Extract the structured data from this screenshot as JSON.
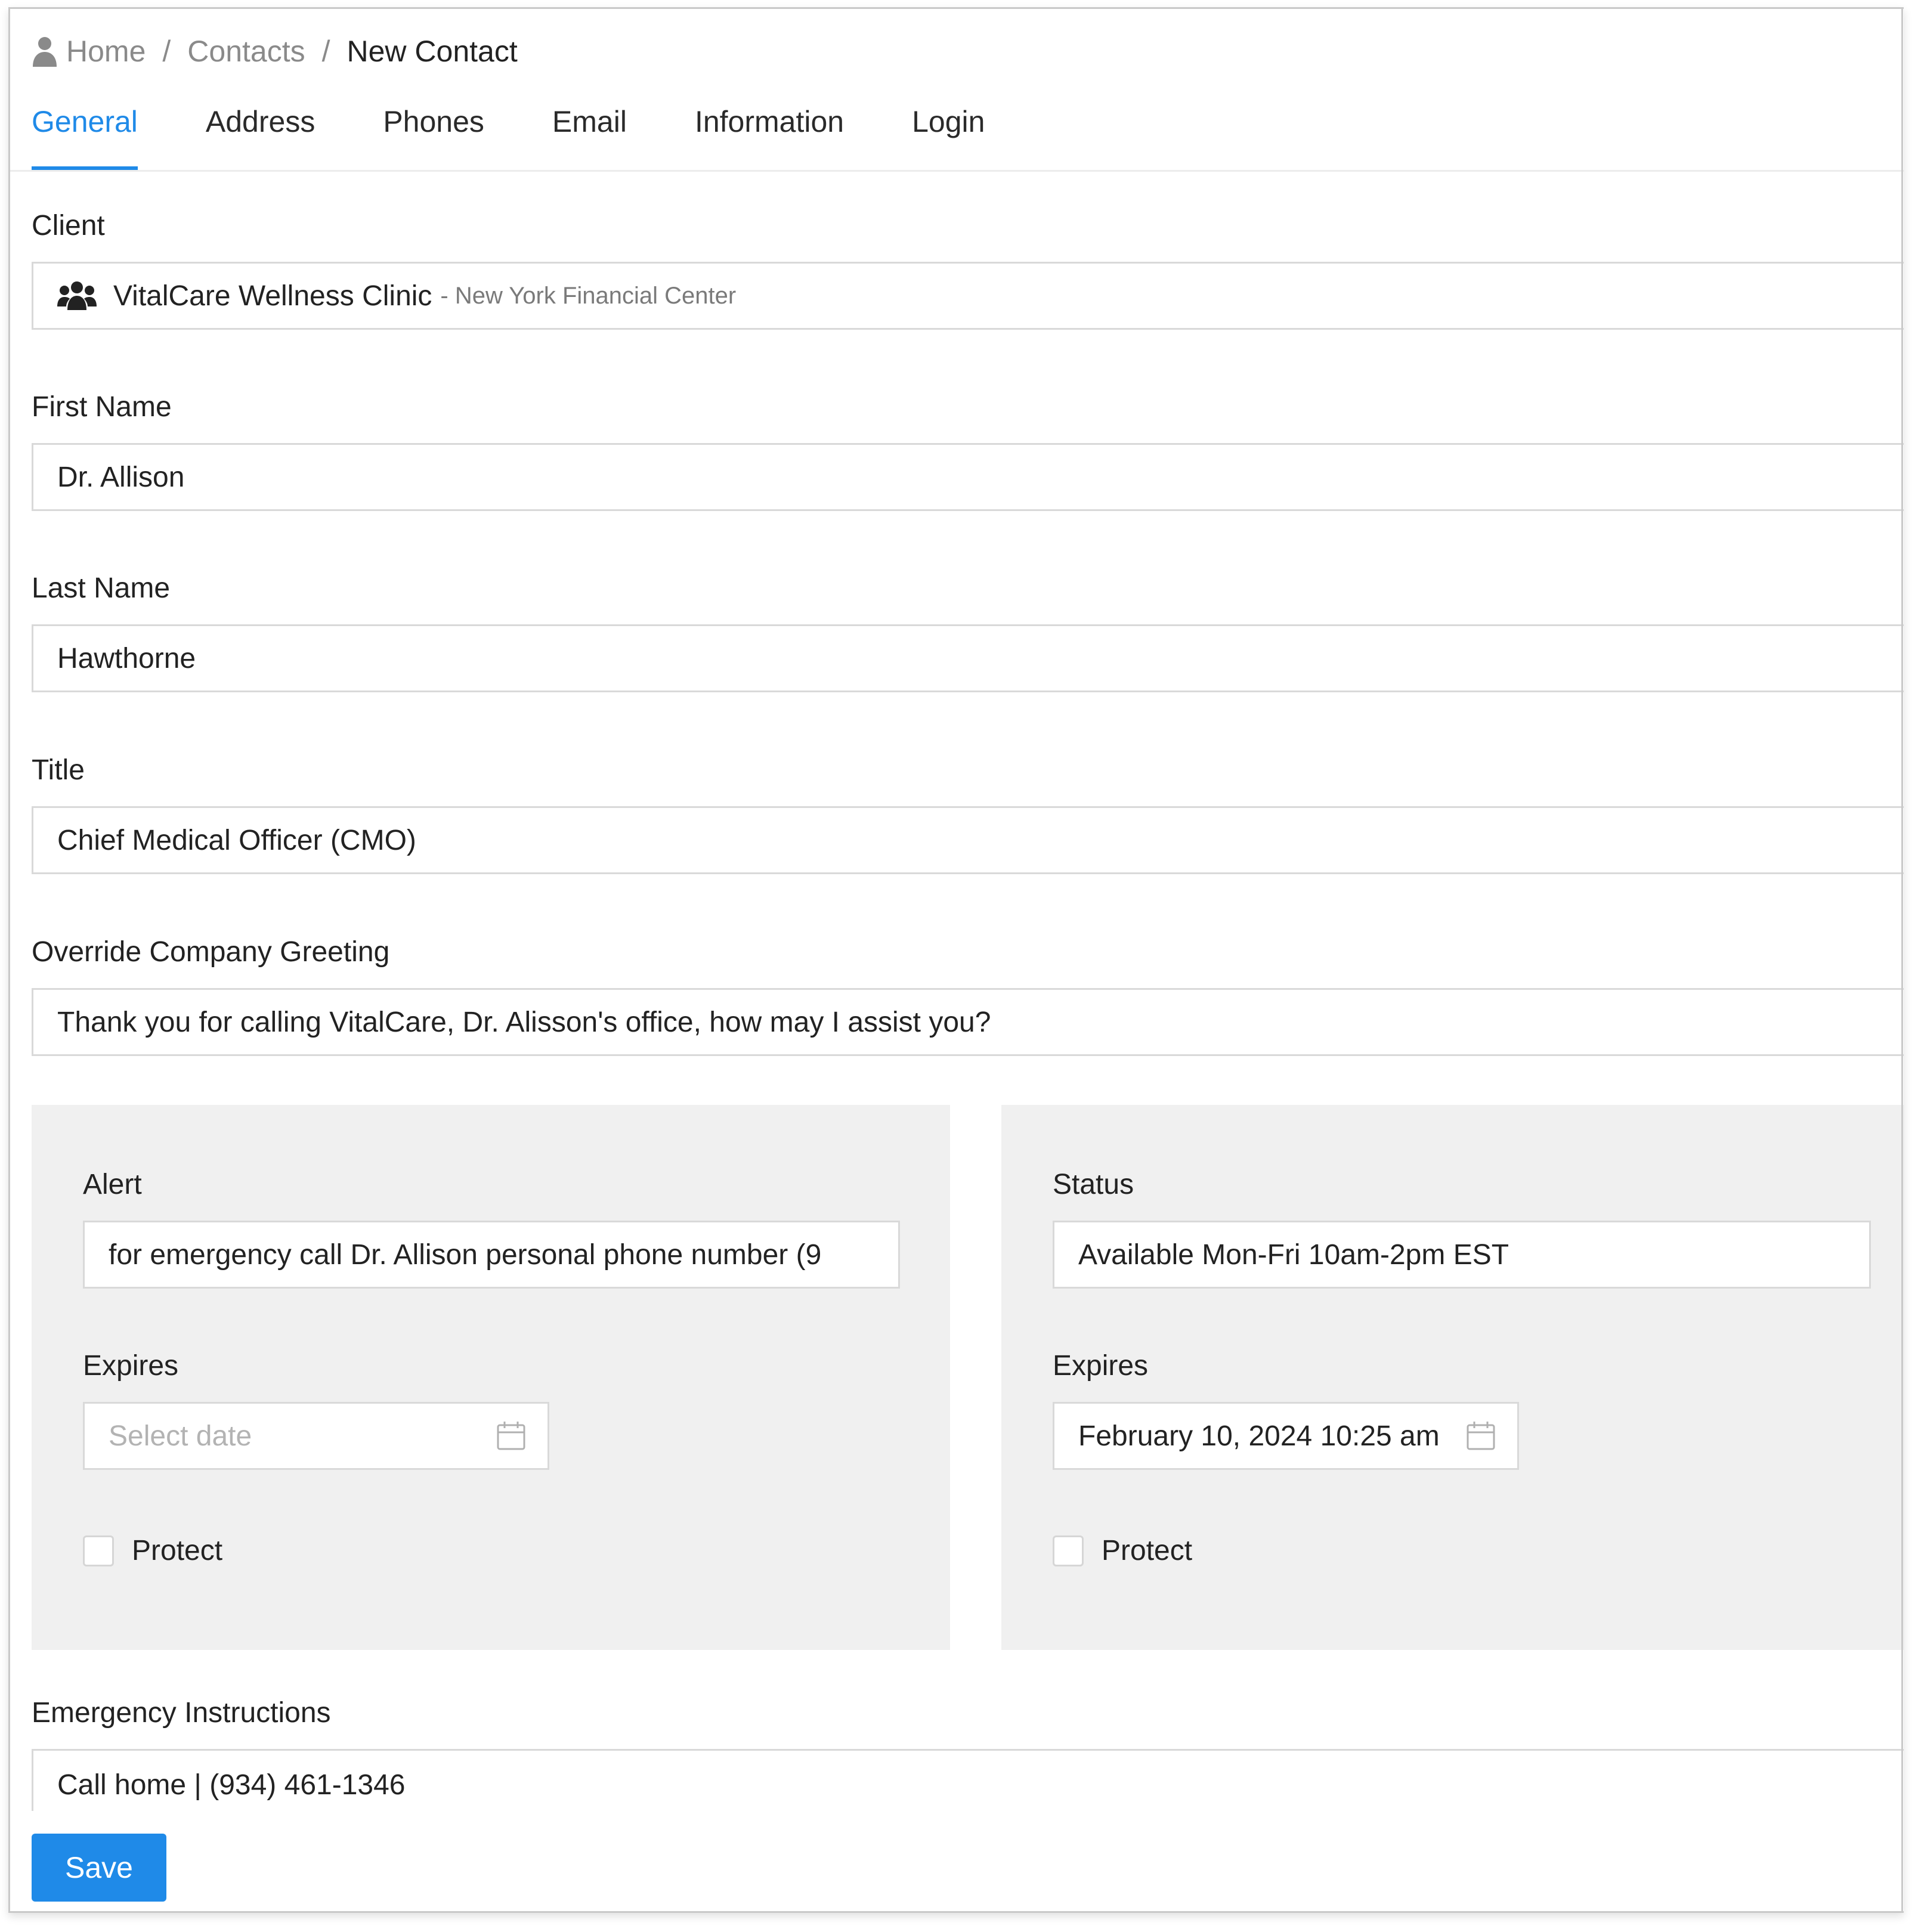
{
  "breadcrumb": {
    "items": [
      "Home",
      "Contacts"
    ],
    "separator": "/",
    "current": "New Contact"
  },
  "tabs": [
    {
      "label": "General",
      "active": true
    },
    {
      "label": "Address",
      "active": false
    },
    {
      "label": "Phones",
      "active": false
    },
    {
      "label": "Email",
      "active": false
    },
    {
      "label": "Information",
      "active": false
    },
    {
      "label": "Login",
      "active": false
    }
  ],
  "form": {
    "client": {
      "label": "Client",
      "name": "VitalCare Wellness Clinic",
      "sub": "- New York Financial Center",
      "icon": "users-icon"
    },
    "first_name": {
      "label": "First Name",
      "value": "Dr. Allison"
    },
    "last_name": {
      "label": "Last Name",
      "value": "Hawthorne"
    },
    "title": {
      "label": "Title",
      "value": "Chief Medical Officer (CMO)"
    },
    "greeting": {
      "label": "Override Company Greeting",
      "value": "Thank you for calling VitalCare, Dr. Alisson's office, how may I assist you?"
    },
    "alert": {
      "label": "Alert",
      "value": "for emergency call Dr. Allison personal phone number (9",
      "expires_label": "Expires",
      "expires_placeholder": "Select date",
      "protect_label": "Protect",
      "protect_checked": false
    },
    "status": {
      "label": "Status",
      "value": "Available Mon-Fri 10am-2pm EST",
      "expires_label": "Expires",
      "expires_value": "February 10, 2024 10:25 am",
      "protect_label": "Protect",
      "protect_checked": false
    },
    "emergency": {
      "label": "Emergency Instructions",
      "value": "Call home | (934) 461-1346"
    }
  },
  "save_label": "Save",
  "colors": {
    "accent": "#1f8ae8",
    "panel": "#f0f0f0",
    "border": "#d9d9d9"
  }
}
